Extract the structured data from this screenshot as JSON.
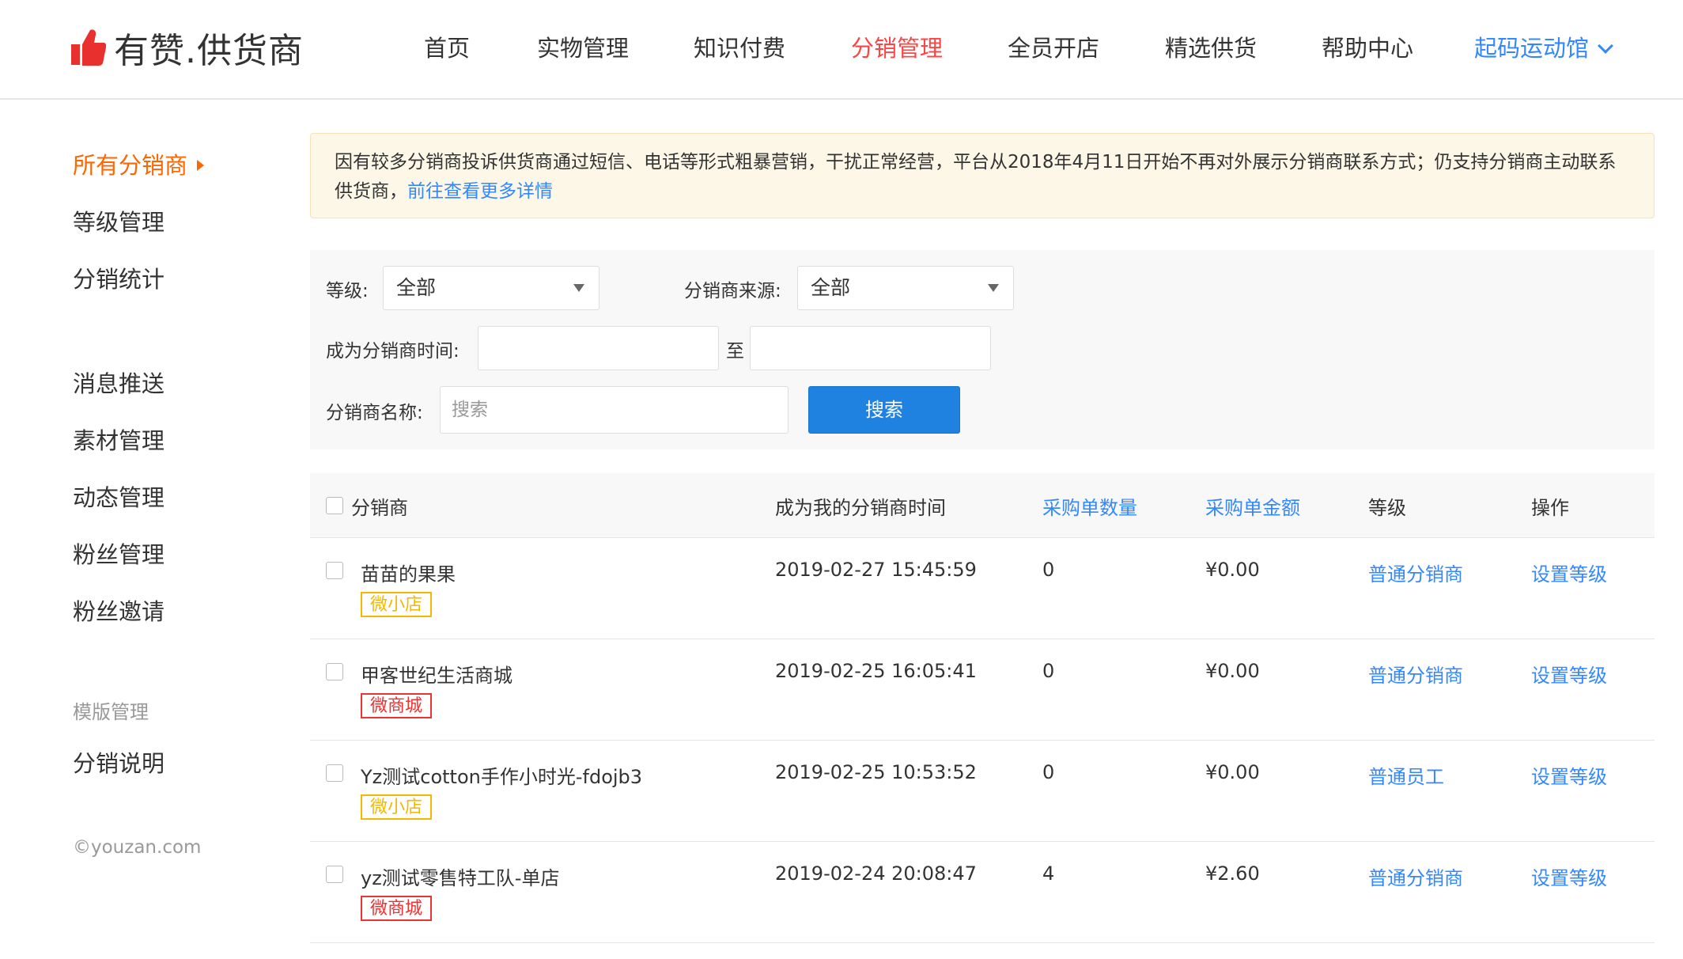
{
  "brand": {
    "name": "有赞.供货商"
  },
  "nav": {
    "items": [
      {
        "label": "首页",
        "active": false
      },
      {
        "label": "实物管理",
        "active": false
      },
      {
        "label": "知识付费",
        "active": false
      },
      {
        "label": "分销管理",
        "active": true
      },
      {
        "label": "全员开店",
        "active": false
      },
      {
        "label": "精选供货",
        "active": false
      },
      {
        "label": "帮助中心",
        "active": false
      }
    ],
    "shop_name": "起码运动馆"
  },
  "sidebar": {
    "items": [
      {
        "label": "所有分销商",
        "active": true
      },
      {
        "label": "等级管理"
      },
      {
        "label": "分销统计"
      },
      {
        "label": "消息推送"
      },
      {
        "label": "素材管理"
      },
      {
        "label": "动态管理"
      },
      {
        "label": "粉丝管理"
      },
      {
        "label": "粉丝邀请"
      }
    ],
    "group_title": "模版管理",
    "group_items": [
      {
        "label": "分销说明"
      }
    ],
    "copyright": "©youzan.com"
  },
  "notice": {
    "text": "因有较多分销商投诉供货商通过短信、电话等形式粗暴营销，干扰正常经营，平台从2018年4月11日开始不再对外展示分销商联系方式；仍支持分销商主动联系供货商，",
    "link": "前往查看更多详情"
  },
  "filter": {
    "level_label": "等级:",
    "level_value": "全部",
    "source_label": "分销商来源:",
    "source_value": "全部",
    "time_label": "成为分销商时间:",
    "time_sep": "至",
    "name_label": "分销商名称:",
    "name_placeholder": "搜索",
    "search_button": "搜索"
  },
  "table": {
    "headers": {
      "distributor": "分销商",
      "joined_time": "成为我的分销商时间",
      "order_count": "采购单数量",
      "order_amount": "采购单金额",
      "level": "等级",
      "action": "操作"
    },
    "rows": [
      {
        "name": "苗苗的果果",
        "tag": "微小店",
        "time": "2019-02-27 15:45:59",
        "count": "0",
        "amount": "¥0.00",
        "level": "普通分销商",
        "action": "设置等级"
      },
      {
        "name": "甲客世纪生活商城",
        "tag": "微商城",
        "time": "2019-02-25 16:05:41",
        "count": "0",
        "amount": "¥0.00",
        "level": "普通分销商",
        "action": "设置等级"
      },
      {
        "name": "Yz测试cotton手作小时光-fdojb3",
        "tag": "微小店",
        "time": "2019-02-25 10:53:52",
        "count": "0",
        "amount": "¥0.00",
        "level": "普通员工",
        "action": "设置等级"
      },
      {
        "name": "yz测试零售特工队-单店",
        "tag": "微商城",
        "time": "2019-02-24 20:08:47",
        "count": "4",
        "amount": "¥2.60",
        "level": "普通分销商",
        "action": "设置等级"
      }
    ]
  },
  "colors": {
    "accent_red": "#ff4444",
    "link_blue": "#3388ff",
    "sidebar_active": "#ff6600",
    "tag_weixiaodian": "#f5b800",
    "tag_weishangcheng": "#ee3333"
  }
}
